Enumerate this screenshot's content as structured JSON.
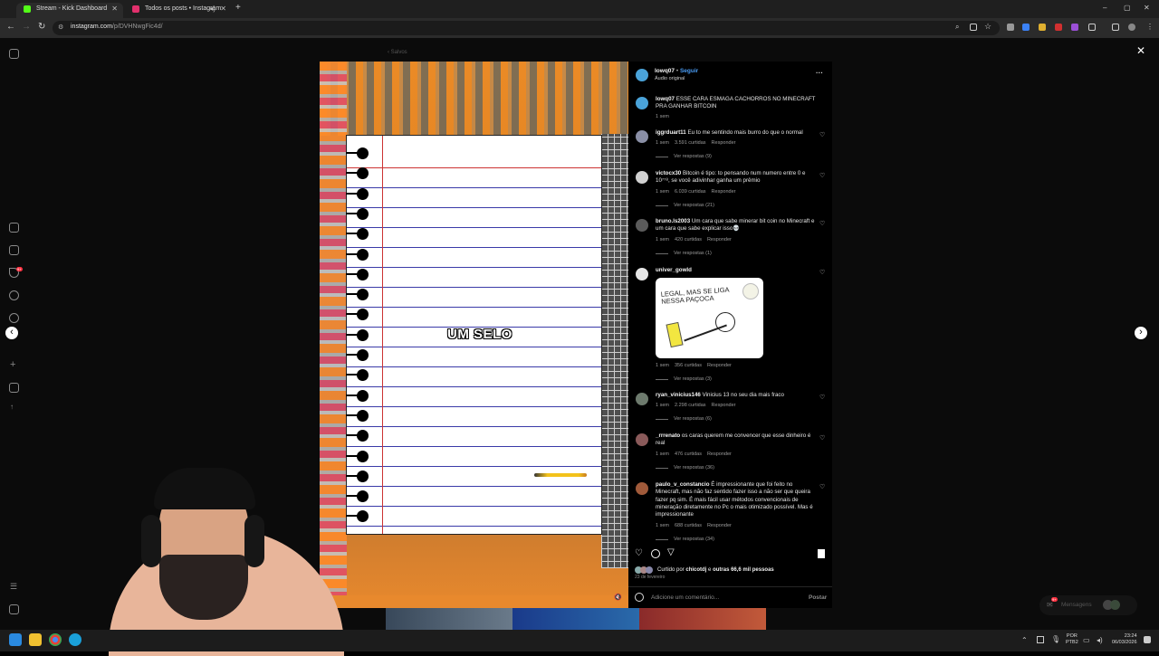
{
  "browser": {
    "tabs": [
      {
        "title": "Stream - Kick Dashboard",
        "favicon_color": "#53fc18"
      },
      {
        "title": "Todos os posts • Instagram",
        "favicon_color": "#e1306c"
      }
    ],
    "new_tab": "+",
    "url_domain": "instagram.com",
    "url_path": "/p/DVHNwgFic4d/",
    "window_controls": [
      "–",
      "▢",
      "✕"
    ]
  },
  "page": {
    "back_label": "Salvos",
    "close_icon": "✕",
    "prev_icon": "‹",
    "next_icon": "›"
  },
  "video": {
    "caption": "UM SELO",
    "mute_icon": "🔇"
  },
  "post": {
    "author": "lowq07",
    "follow": "Seguir",
    "dot": "•",
    "audio": "Áudio original",
    "more_icon": "···",
    "caption_user": "lowq07",
    "caption_text": "ESSE CARA ESMAGA CACHORROS NO MINECRAFT PRA GANHAR BITCOIN",
    "caption_time": "1 sem",
    "likes_prefix": "Curtido por",
    "likes_user": "chicotdj",
    "likes_mid": "e",
    "likes_others": "outras 66,6 mil pessoas",
    "date": "23 de fevereiro",
    "comment_placeholder": "Adicione um comentário...",
    "post_button": "Postar"
  },
  "comments": [
    {
      "user": "iggrduart11",
      "text": "Eu to me sentindo mais burro do que o normal",
      "time": "1 sem",
      "likes": "3.591 curtidas",
      "reply": "Responder",
      "replies": "Ver respostas (9)",
      "avatar_color": "#8a8fa6"
    },
    {
      "user": "victocx30",
      "text": "Bitcoin é tipo: to pensando num numero entre 0 e 10⁷⁷⁸, se você adivinhar ganha um prêmio",
      "time": "1 sem",
      "likes": "6.039 curtidas",
      "reply": "Responder",
      "replies": "Ver respostas (21)",
      "avatar_color": "#d0d0d0"
    },
    {
      "user": "bruno.ls2003",
      "text": "Um cara que sabe minerar bit coin no Minecraft e um cara que sabe explicar isso💀",
      "time": "1 sem",
      "likes": "420 curtidas",
      "reply": "Responder",
      "replies": "Ver respostas (1)",
      "avatar_color": "#5b5b5b"
    },
    {
      "user": "univer_gowld",
      "text": "",
      "sticker_text": "LEGAL, MAS SE LIGA NESSA PAÇOCA",
      "time": "1 sem",
      "likes": "356 curtidas",
      "reply": "Responder",
      "replies": "Ver respostas (3)",
      "avatar_color": "#e6e6e6"
    },
    {
      "user": "ryan_vinicius146",
      "text": "Vinicius 13 no seu dia mais fraco",
      "time": "1 sem",
      "likes": "2.298 curtidas",
      "reply": "Responder",
      "replies": "Ver respostas (6)",
      "avatar_color": "#6d7a6d"
    },
    {
      "user": "_rrrenato",
      "text": "os caras querem me convencer que esse dinheiro é real",
      "time": "1 sem",
      "likes": "476 curtidas",
      "reply": "Responder",
      "replies": "Ver respostas (36)",
      "avatar_color": "#8a5a5a"
    },
    {
      "user": "paulo_v_constancio",
      "text": "É impressionante que foi feito no Minecraft, mas não faz sentido fazer isso a não ser que queira fazer pq sim. É mais fácil usar métodos convencionais de mineração diretamente no Pc o mais otimizado possível. Mas é impressionante",
      "time": "1 sem",
      "likes": "688 curtidas",
      "reply": "Responder",
      "replies": "Ver respostas (34)",
      "avatar_color": "#a05a3a"
    }
  ],
  "messages_widget": {
    "label": "Mensagens",
    "badge": "9+"
  },
  "notif_badge": "9+",
  "taskbar": {
    "lang_top": "POR",
    "lang_bottom": "PTB2",
    "time": "23:24",
    "date": "06/03/2026"
  }
}
